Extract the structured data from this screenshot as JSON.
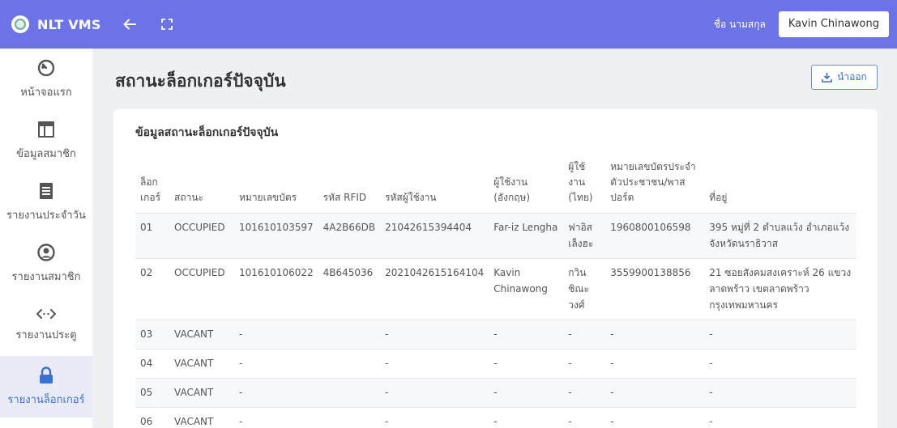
{
  "app": {
    "title": "NLT VMS"
  },
  "topbar": {
    "name_label": "ชื่อ นามสกุล",
    "user_name": "Kavin Chinawong"
  },
  "sidebar": {
    "items": [
      {
        "label": "หน้าจอแรก",
        "icon": "dashboard-icon"
      },
      {
        "label": "ข้อมูลสมาชิก",
        "icon": "layout-icon"
      },
      {
        "label": "รายงานประจำวัน",
        "icon": "document-icon"
      },
      {
        "label": "รายงานสมาชิก",
        "icon": "user-circle-icon"
      },
      {
        "label": "รายงานประตู",
        "icon": "code-arrows-icon"
      },
      {
        "label": "รายงานล็อกเกอร์",
        "icon": "lock-icon",
        "active": true
      }
    ]
  },
  "page": {
    "title": "สถานะล็อกเกอร์ปัจจุบัน",
    "export_label": "นำออก"
  },
  "card": {
    "title": "ข้อมูลสถานะล็อกเกอร์ปัจจุบัน"
  },
  "table": {
    "headers": [
      "ล็อก\nเกอร์",
      "สถานะ",
      "หมายเลขบัตร",
      "รหัส RFID",
      "รหัสผู้ใช้งาน",
      "ผู้ใช้งาน\n(อังกฤษ)",
      "ผู้ใช้\nงาน\n(ไทย)",
      "หมายเลขบัตรประจำ\nตัวประชาชน/พาส\nปอร์ต",
      "ที่อยู่"
    ],
    "rows": [
      [
        "01",
        "OCCUPIED",
        "101610103597",
        "4A2B66DB",
        "21042615394404",
        "Far-iz Lengha",
        "ฟาอิส\nเล็งฮะ",
        "1960800106598",
        "395 หมู่ที่ 2 ตำบลแว้ง อำเภอแว้ง\nจังหวัดนราธิวาส"
      ],
      [
        "02",
        "OCCUPIED",
        "101610106022",
        "4B645036",
        "2021042615164104",
        "Kavin\nChinawong",
        "กวิน\nชิณะ\nวงศ์",
        "3559900138856",
        "21 ซอยสังคมสงเคราะห์ 26 แขวง\nลาดพร้าว เขตลาดพร้าว\nกรุงเทพมหานคร"
      ],
      [
        "03",
        "VACANT",
        "-",
        "",
        "-",
        "-",
        "-",
        "-",
        "-"
      ],
      [
        "04",
        "VACANT",
        "-",
        "",
        "-",
        "-",
        "-",
        "-",
        "-"
      ],
      [
        "05",
        "VACANT",
        "-",
        "",
        "-",
        "-",
        "-",
        "-",
        "-"
      ],
      [
        "06",
        "VACANT",
        "-",
        "",
        "-",
        "-",
        "-",
        "-",
        "-"
      ]
    ]
  }
}
